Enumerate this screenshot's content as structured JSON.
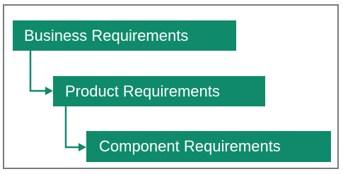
{
  "diagram": {
    "nodes": [
      {
        "id": "business",
        "label": "Business Requirements"
      },
      {
        "id": "product",
        "label": "Product Requirements"
      },
      {
        "id": "component",
        "label": "Component Requirements"
      }
    ],
    "edges": [
      {
        "from": "business",
        "to": "product"
      },
      {
        "from": "product",
        "to": "component"
      }
    ]
  },
  "colors": {
    "node_fill": "#0f8b6b",
    "node_text": "#ffffff",
    "frame_border": "#7a7a7a"
  }
}
